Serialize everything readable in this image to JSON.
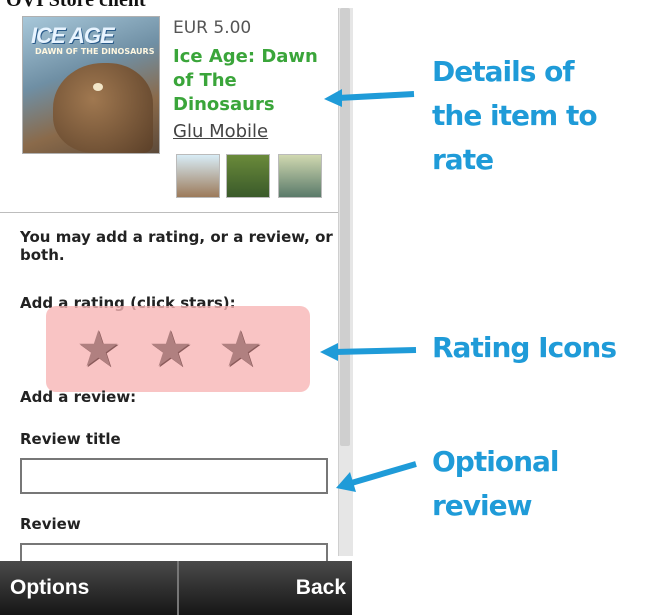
{
  "header": {
    "title": "OVI Store client"
  },
  "item": {
    "price": "EUR 5.00",
    "title": "Ice Age: Dawn of The Dinosaurs",
    "vendor": "Glu Mobile",
    "cover_logo": "ICE AGE",
    "cover_subtitle": "DAWN OF THE DINOSAURS"
  },
  "rating_form": {
    "intro": "You may add a rating, or a review, or both.",
    "rating_label": "Add a rating (click stars):",
    "stars": [
      "★",
      "★",
      "★"
    ],
    "review_heading": "Add a review:",
    "review_title_label": "Review title",
    "review_title_value": "",
    "review_label": "Review",
    "review_value": ""
  },
  "softkeys": {
    "left": "Options",
    "right": "Back"
  },
  "annotations": {
    "details_line1": "Details of",
    "details_line2": "the item to rate",
    "rating_icons": "Rating Icons",
    "optional_review": "Optional review"
  },
  "colors": {
    "annotation": "#1f9bd8",
    "title_green": "#3aa53a",
    "rating_highlight": "#f7b5b5"
  }
}
